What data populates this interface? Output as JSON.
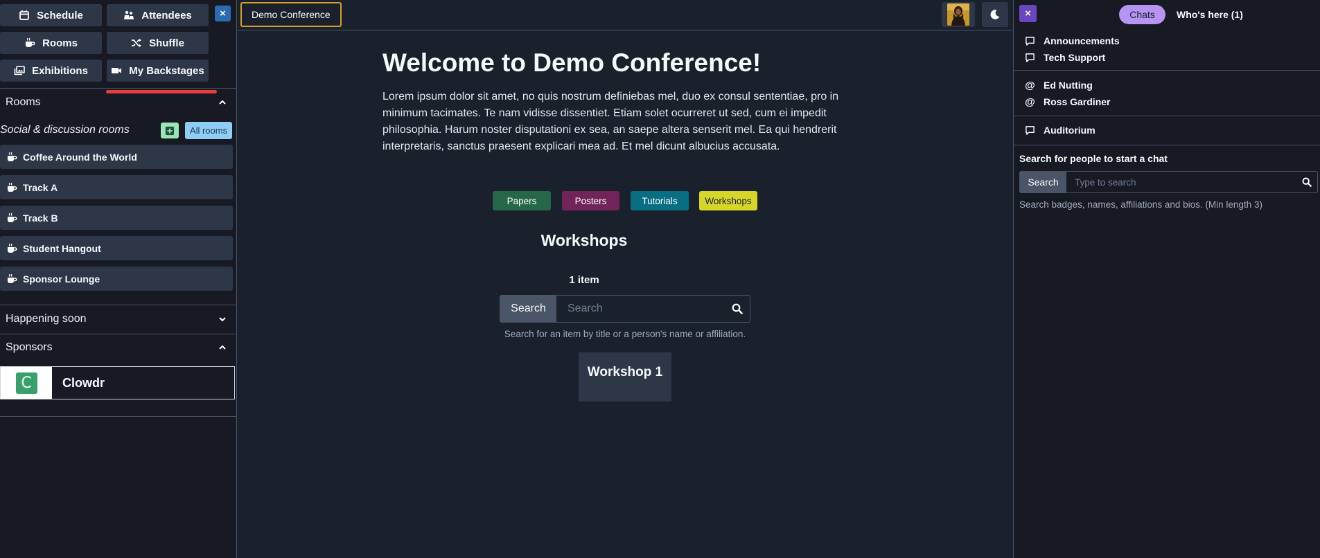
{
  "left": {
    "nav": {
      "schedule": "Schedule",
      "attendees": "Attendees",
      "rooms": "Rooms",
      "shuffle": "Shuffle",
      "exhibitions": "Exhibitions",
      "my_backstages": "My Backstages",
      "close": "×"
    },
    "rooms_section": {
      "title": "Rooms",
      "subheading": "Social & discussion rooms",
      "all_rooms_label": "All rooms",
      "items": [
        {
          "label": "Coffee Around the World"
        },
        {
          "label": "Track A"
        },
        {
          "label": "Track B"
        },
        {
          "label": "Student Hangout"
        },
        {
          "label": "Sponsor Lounge"
        }
      ]
    },
    "happening_soon": {
      "title": "Happening soon"
    },
    "sponsors": {
      "title": "Sponsors",
      "items": [
        {
          "name": "Clowdr",
          "logo_letter": "C"
        }
      ]
    }
  },
  "main": {
    "conference_button": "Demo Conference",
    "welcome_title": "Welcome to Demo Conference!",
    "intro_text": "Lorem ipsum dolor sit amet, no quis nostrum definiebas mel, duo ex consul sententiae, pro in minimum tacimates. Te nam vidisse dissentiet. Etiam solet ocurreret ut sed, cum ei impedit philosophia. Harum noster disputationi ex sea, an saepe altera senserit mel. Ea qui hendrerit interpretaris, sanctus praesent explicari mea ad. Et mel dicunt albucius accusata.",
    "categories": [
      {
        "label": "Papers",
        "bg": "#276749",
        "fg": "#ffffff"
      },
      {
        "label": "Posters",
        "bg": "#702459",
        "fg": "#ffffff"
      },
      {
        "label": "Tutorials",
        "bg": "#086f83",
        "fg": "#ffffff"
      },
      {
        "label": "Workshops",
        "bg": "#d6d629",
        "fg": "#1a202c"
      }
    ],
    "section_title": "Workshops",
    "item_count": "1 item",
    "search": {
      "button": "Search",
      "placeholder": "Search",
      "helper": "Search for an item by title or a person's name or affiliation."
    },
    "items": [
      {
        "title": "Workshop 1"
      }
    ]
  },
  "right": {
    "close": "×",
    "tabs": {
      "chats": "Chats",
      "whos_here": "Who's here (1)"
    },
    "channels": [
      {
        "label": "Announcements"
      },
      {
        "label": "Tech Support"
      }
    ],
    "direct": [
      {
        "label": "Ed Nutting"
      },
      {
        "label": "Ross Gardiner"
      }
    ],
    "rooms": [
      {
        "label": "Auditorium"
      }
    ],
    "people_search": {
      "title": "Search for people to start a chat",
      "button": "Search",
      "placeholder": "Type to search",
      "helper": "Search badges, names, affiliations and bios. (Min length 3)"
    }
  },
  "colors": {
    "accent_purple": "#b794f4",
    "conference_border": "#d69e2e",
    "active_underline": "#e53e3e"
  }
}
